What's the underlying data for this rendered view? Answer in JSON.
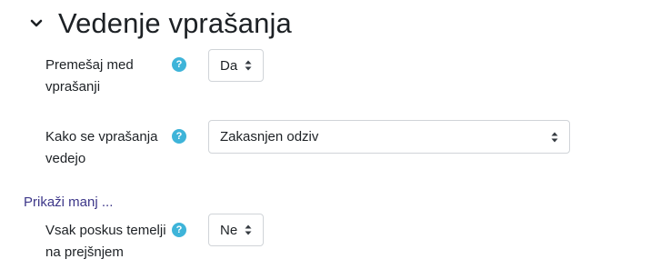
{
  "section": {
    "title": "Vedenje vprašanja"
  },
  "fields": {
    "shuffle": {
      "label_line1": "Premešaj med",
      "label_line2": "vprašanji",
      "value": "Da"
    },
    "behaviour": {
      "label_line1": "Kako se vprašanja",
      "label_line2": "vedejo",
      "value": "Zakasnjen odziv"
    },
    "build_on_last": {
      "label_line1": "Vsak poskus temelji",
      "label_line2": "na prejšnjem",
      "value": "Ne"
    }
  },
  "links": {
    "show_less": "Prikaži manj ..."
  },
  "icons": {
    "help_glyph": "?",
    "help_color": "#3eb4d9",
    "chevron": "chevron-down-icon"
  },
  "colors": {
    "link": "#3d3789",
    "text": "#1d2125"
  }
}
